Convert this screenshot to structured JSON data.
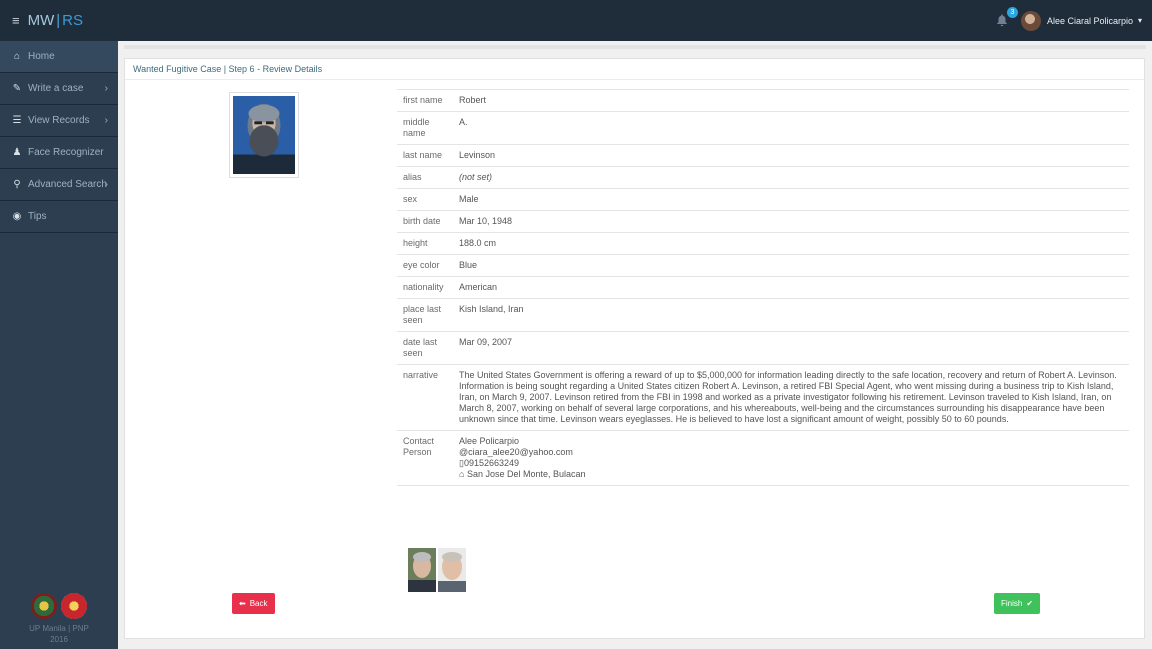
{
  "brand": {
    "menu_icon": "≡",
    "mw": "MW",
    "sep": "|",
    "irs": "RS"
  },
  "header": {
    "notification_count": "3",
    "user_name": "Alee Ciaral Policarpio",
    "caret": "▾"
  },
  "sidebar": {
    "items": [
      {
        "label": "Home",
        "icon": "home-icon",
        "glyph": "⌂",
        "arrow": ""
      },
      {
        "label": "Write a case",
        "icon": "edit-icon",
        "glyph": "✎",
        "arrow": "›"
      },
      {
        "label": "View Records",
        "icon": "list-icon",
        "glyph": "☰",
        "arrow": "›"
      },
      {
        "label": "Face Recognizer",
        "icon": "user-icon",
        "glyph": "♟",
        "arrow": ""
      },
      {
        "label": "Advanced Search",
        "icon": "search-icon",
        "glyph": "⚲",
        "arrow": "›"
      },
      {
        "label": "Tips",
        "icon": "eye-icon",
        "glyph": "◉",
        "arrow": ""
      }
    ],
    "footer": {
      "line1": "UP Manila | PNP",
      "line2": "2016"
    }
  },
  "panel": {
    "title": "Wanted Fugitive Case | Step 6 - Review Details"
  },
  "details": {
    "first_name_label": "first name",
    "first_name": "Robert",
    "middle_name_label": "middle name",
    "middle_name": "A.",
    "last_name_label": "last name",
    "last_name": "Levinson",
    "alias_label": "alias",
    "alias": "(not set)",
    "sex_label": "sex",
    "sex": "Male",
    "birth_date_label": "birth date",
    "birth_date": "Mar 10, 1948",
    "height_label": "height",
    "height": "188.0 cm",
    "eye_color_label": "eye color",
    "eye_color": "Blue",
    "nationality_label": "nationality",
    "nationality": "American",
    "place_last_seen_label": "place last seen",
    "place_last_seen": "Kish Island, Iran",
    "date_last_seen_label": "date last seen",
    "date_last_seen": "Mar 09, 2007",
    "narrative_label": "narrative",
    "narrative": "The United States Government is offering a reward of up to $5,000,000 for information leading directly to the safe location, recovery and return of Robert A. Levinson. Information is being sought regarding a United States citizen Robert A. Levinson, a retired FBI Special Agent, who went missing during a business trip to Kish Island, Iran, on March 9, 2007. Levinson retired from the FBI in 1998 and worked as a private investigator following his retirement. Levinson traveled to Kish Island, Iran, on March 8, 2007, working on behalf of several large corporations, and his whereabouts, well-being and the circumstances surrounding his disappearance have been unknown since that time. Levinson wears eyeglasses. He is believed to have lost a significant amount of weight, possibly 50 to 60 pounds.",
    "contact_label": "Contact Person",
    "contact_name": "Alee Policarpio",
    "contact_email": "@ciara_alee20@yahoo.com",
    "contact_phone": "▯09152663249",
    "contact_address": "San Jose Del Monte, Bulacan"
  },
  "buttons": {
    "back": "Back",
    "finish": "Finish"
  }
}
